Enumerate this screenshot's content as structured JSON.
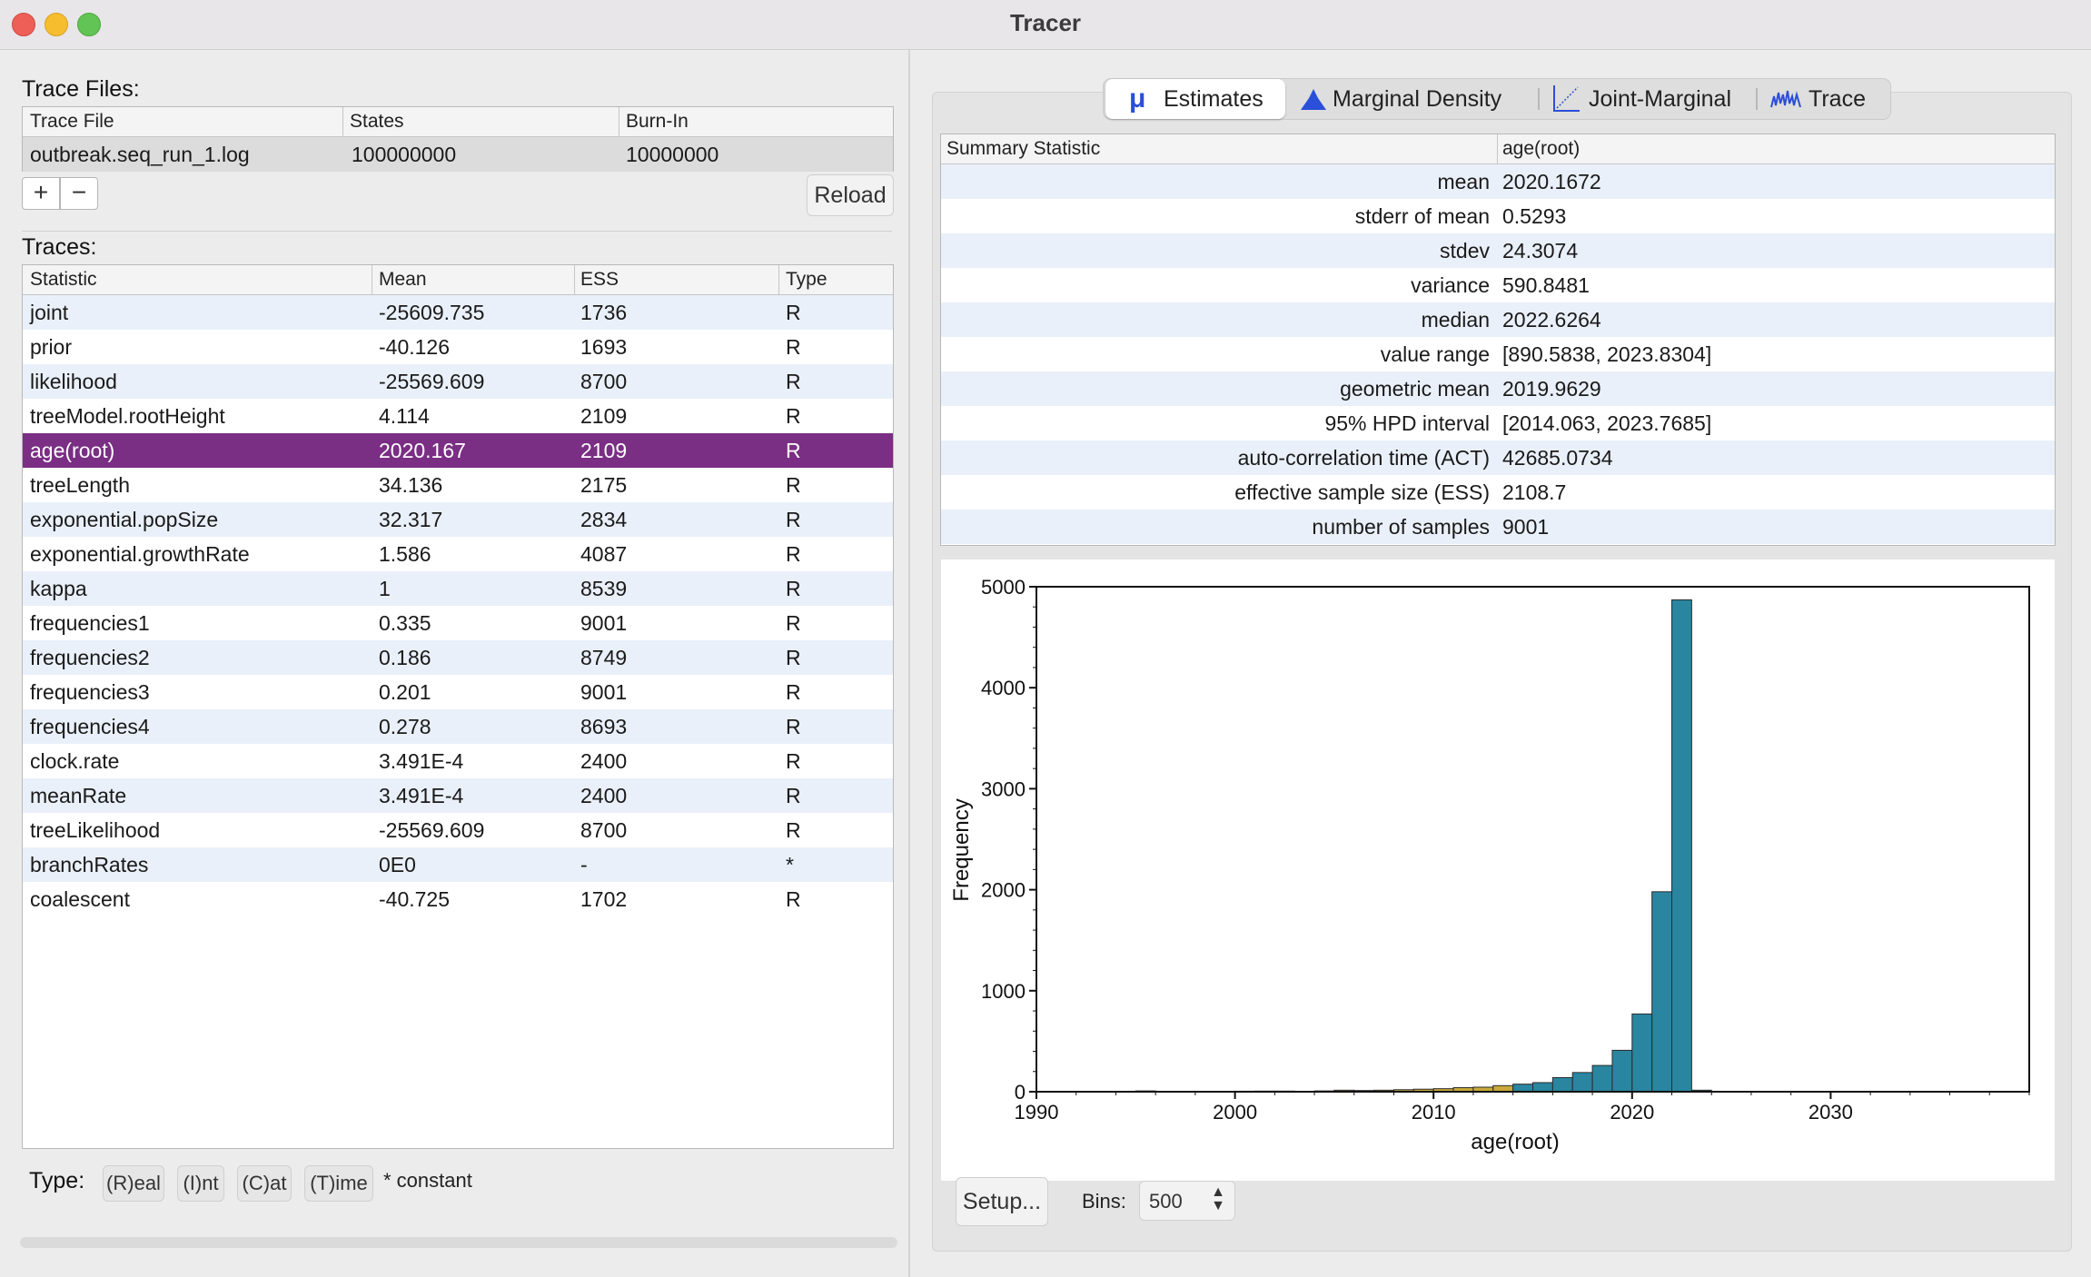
{
  "window": {
    "title": "Tracer"
  },
  "trace_files": {
    "label": "Trace Files:",
    "headers": [
      "Trace File",
      "States",
      "Burn-In"
    ],
    "rows": [
      {
        "file": "outbreak.seq_run_1.log",
        "states": "100000000",
        "burnin": "10000000"
      }
    ],
    "add_label": "+",
    "remove_label": "−",
    "reload_label": "Reload"
  },
  "traces": {
    "label": "Traces:",
    "headers": [
      "Statistic",
      "Mean",
      "ESS",
      "Type"
    ],
    "selected_index": 4,
    "rows": [
      {
        "stat": "joint",
        "mean": "-25609.735",
        "ess": "1736",
        "type": "R"
      },
      {
        "stat": "prior",
        "mean": "-40.126",
        "ess": "1693",
        "type": "R"
      },
      {
        "stat": "likelihood",
        "mean": "-25569.609",
        "ess": "8700",
        "type": "R"
      },
      {
        "stat": "treeModel.rootHeight",
        "mean": "4.114",
        "ess": "2109",
        "type": "R"
      },
      {
        "stat": "age(root)",
        "mean": "2020.167",
        "ess": "2109",
        "type": "R"
      },
      {
        "stat": "treeLength",
        "mean": "34.136",
        "ess": "2175",
        "type": "R"
      },
      {
        "stat": "exponential.popSize",
        "mean": "32.317",
        "ess": "2834",
        "type": "R"
      },
      {
        "stat": "exponential.growthRate",
        "mean": "1.586",
        "ess": "4087",
        "type": "R"
      },
      {
        "stat": "kappa",
        "mean": "1",
        "ess": "8539",
        "type": "R"
      },
      {
        "stat": "frequencies1",
        "mean": "0.335",
        "ess": "9001",
        "type": "R"
      },
      {
        "stat": "frequencies2",
        "mean": "0.186",
        "ess": "8749",
        "type": "R"
      },
      {
        "stat": "frequencies3",
        "mean": "0.201",
        "ess": "9001",
        "type": "R"
      },
      {
        "stat": "frequencies4",
        "mean": "0.278",
        "ess": "8693",
        "type": "R"
      },
      {
        "stat": "clock.rate",
        "mean": "3.491E-4",
        "ess": "2400",
        "type": "R"
      },
      {
        "stat": "meanRate",
        "mean": "3.491E-4",
        "ess": "2400",
        "type": "R"
      },
      {
        "stat": "treeLikelihood",
        "mean": "-25569.609",
        "ess": "8700",
        "type": "R"
      },
      {
        "stat": "branchRates",
        "mean": "0E0",
        "ess": "-",
        "type": "*"
      },
      {
        "stat": "coalescent",
        "mean": "-40.725",
        "ess": "1702",
        "type": "R"
      }
    ]
  },
  "type_legend": {
    "label": "Type:",
    "chips": [
      "(R)eal",
      "(I)nt",
      "(C)at",
      "(T)ime"
    ],
    "constant_note": "* constant"
  },
  "tabs": [
    {
      "label": "Estimates",
      "icon": "mu-icon",
      "active": true
    },
    {
      "label": "Marginal Density",
      "icon": "density-icon",
      "active": false
    },
    {
      "label": "Joint-Marginal",
      "icon": "scatter-icon",
      "active": false
    },
    {
      "label": "Trace",
      "icon": "trace-icon",
      "active": false
    }
  ],
  "summary": {
    "headers": [
      "Summary Statistic",
      "age(root)"
    ],
    "rows": [
      {
        "name": "mean",
        "value": "2020.1672"
      },
      {
        "name": "stderr of mean",
        "value": "0.5293"
      },
      {
        "name": "stdev",
        "value": "24.3074"
      },
      {
        "name": "variance",
        "value": "590.8481"
      },
      {
        "name": "median",
        "value": "2022.6264"
      },
      {
        "name": "value range",
        "value": "[890.5838, 2023.8304]"
      },
      {
        "name": "geometric mean",
        "value": "2019.9629"
      },
      {
        "name": "95% HPD interval",
        "value": "[2014.063, 2023.7685]"
      },
      {
        "name": "auto-correlation time (ACT)",
        "value": "42685.0734"
      },
      {
        "name": "effective sample size (ESS)",
        "value": "2108.7"
      },
      {
        "name": "number of samples",
        "value": "9001"
      }
    ]
  },
  "controls": {
    "setup_label": "Setup...",
    "bins_label": "Bins:",
    "bins_value": "500"
  },
  "colors": {
    "selection": "#7a2e84",
    "bar_main": "#2a85a0",
    "bar_burn": "#c9a93a",
    "row_alt": "#eaf0f9"
  },
  "chart_data": {
    "type": "bar",
    "xlabel": "age(root)",
    "ylabel": "Frequency",
    "xlim": [
      1990,
      2040
    ],
    "ylim": [
      0,
      5000
    ],
    "xticks": [
      1990,
      2000,
      2010,
      2020,
      2030
    ],
    "yticks": [
      0,
      1000,
      2000,
      3000,
      4000,
      5000
    ],
    "bin_width": 1,
    "bars": [
      {
        "x": 1995,
        "y": 8,
        "hpd": false
      },
      {
        "x": 2000,
        "y": 5,
        "hpd": false
      },
      {
        "x": 2001,
        "y": 6,
        "hpd": false
      },
      {
        "x": 2002,
        "y": 6,
        "hpd": false
      },
      {
        "x": 2004,
        "y": 8,
        "hpd": false
      },
      {
        "x": 2005,
        "y": 15,
        "hpd": false
      },
      {
        "x": 2006,
        "y": 12,
        "hpd": false
      },
      {
        "x": 2007,
        "y": 15,
        "hpd": false
      },
      {
        "x": 2008,
        "y": 20,
        "hpd": false
      },
      {
        "x": 2009,
        "y": 25,
        "hpd": false
      },
      {
        "x": 2010,
        "y": 30,
        "hpd": false
      },
      {
        "x": 2011,
        "y": 40,
        "hpd": false
      },
      {
        "x": 2012,
        "y": 45,
        "hpd": false
      },
      {
        "x": 2013,
        "y": 60,
        "hpd": false
      },
      {
        "x": 2014,
        "y": 75,
        "hpd": true
      },
      {
        "x": 2015,
        "y": 90,
        "hpd": true
      },
      {
        "x": 2016,
        "y": 140,
        "hpd": true
      },
      {
        "x": 2017,
        "y": 190,
        "hpd": true
      },
      {
        "x": 2018,
        "y": 260,
        "hpd": true
      },
      {
        "x": 2019,
        "y": 410,
        "hpd": true
      },
      {
        "x": 2020,
        "y": 770,
        "hpd": true
      },
      {
        "x": 2021,
        "y": 1980,
        "hpd": true
      },
      {
        "x": 2022,
        "y": 4870,
        "hpd": true
      },
      {
        "x": 2023,
        "y": 15,
        "hpd": true
      }
    ]
  }
}
